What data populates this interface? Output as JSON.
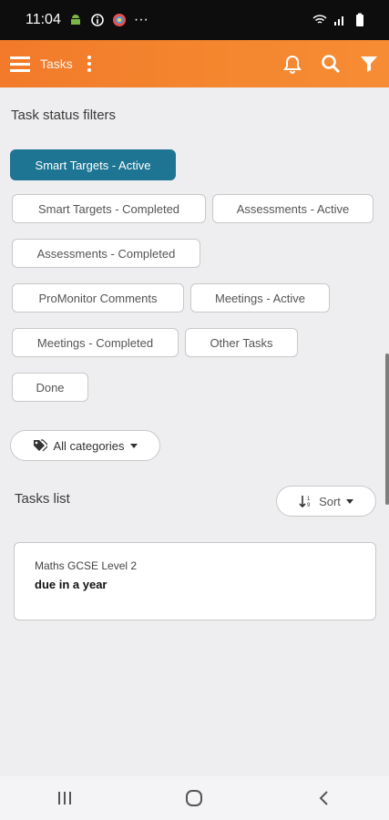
{
  "status_bar": {
    "time": "11:04"
  },
  "app_bar": {
    "title": "Tasks"
  },
  "filters": {
    "title": "Task status filters",
    "chips": [
      "Smart Targets - Active",
      "Smart Targets - Completed",
      "Assessments - Active",
      "Assessments - Completed",
      "ProMonitor Comments",
      "Meetings - Active",
      "Meetings - Completed",
      "Other Tasks",
      "Done"
    ],
    "active_index": 0
  },
  "categories": {
    "label": "All categories"
  },
  "tasks": {
    "title": "Tasks list",
    "sort_label": "Sort",
    "items": [
      {
        "name": "Maths GCSE Level 2",
        "due": "due in a year"
      }
    ]
  },
  "colors": {
    "accent": "#f4862f",
    "active_chip": "#1d7593"
  }
}
